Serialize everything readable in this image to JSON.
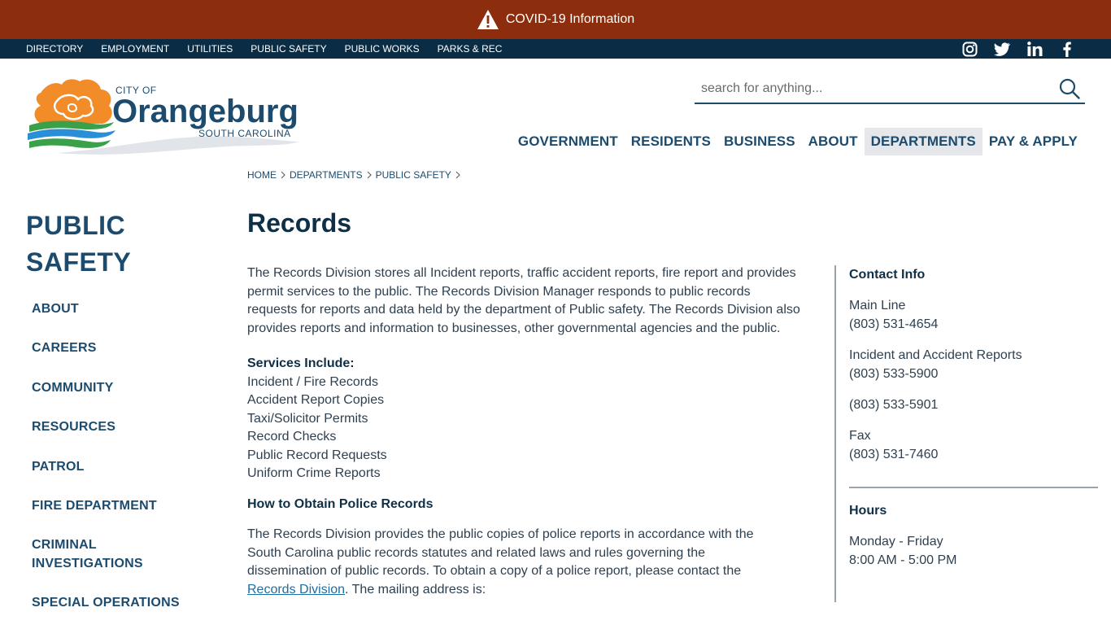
{
  "alert": {
    "label": "COVID-19 Information"
  },
  "utility_nav": [
    "DIRECTORY",
    "EMPLOYMENT",
    "UTILITIES",
    "PUBLIC SAFETY",
    "PUBLIC WORKS",
    "PARKS & REC"
  ],
  "logo": {
    "city_of": "CITY OF",
    "name": "Orangeburg",
    "state": "SOUTH CAROLINA"
  },
  "search": {
    "placeholder": "search for anything..."
  },
  "main_nav": [
    "GOVERNMENT",
    "RESIDENTS",
    "BUSINESS",
    "ABOUT",
    "DEPARTMENTS",
    "PAY & APPLY"
  ],
  "breadcrumb": [
    "HOME",
    "DEPARTMENTS",
    "PUBLIC SAFETY"
  ],
  "sidebar": {
    "title_line1": "PUBLIC",
    "title_line2": "SAFETY",
    "items": [
      "ABOUT",
      "CAREERS",
      "COMMUNITY",
      "RESOURCES",
      "PATROL",
      "FIRE DEPARTMENT",
      "CRIMINAL INVESTIGATIONS",
      "SPECIAL OPERATIONS"
    ]
  },
  "page": {
    "title": "Records",
    "intro": "The Records Division stores all Incident reports, traffic accident reports, fire report and provides permit services to the public. The Records Division Manager responds to public records requests for reports and data held by the department of Public safety. The Records Division also provides reports and information to businesses, other governmental agencies and the public.",
    "services_heading": "Services Include:",
    "services": [
      "Incident / Fire Records",
      "Accident Report Copies",
      "Taxi/Solicitor Permits",
      "Record Checks",
      "Public Record Requests",
      "Uniform Crime Reports"
    ],
    "police_heading": "How to Obtain Police Records",
    "police_text": "The Records Division provides the public copies of police reports in accordance with the South Carolina public records statutes and related laws and rules governing the dissemination of public records. To obtain a copy of a police report, please contact the",
    "police_link": "Records Division",
    "police_tail": ". The mailing address is:"
  },
  "contact": {
    "heading": "Contact Info",
    "main_label": "Main Line",
    "main_phone": "(803) 531-4654",
    "incident_label": "Incident and Accident Reports",
    "incident_phone": "(803) 533-5900",
    "second_phone": "(803) 533-5901",
    "fax_label": "Fax",
    "fax_phone": "(803) 531-7460",
    "hours_heading": "Hours",
    "hours_days": "Monday - Friday",
    "hours_time": "8:00 AM - 5:00 PM"
  },
  "colors": {
    "alert_bg": "#8c2e0d",
    "utility_bg": "#0b2c45",
    "brand_blue": "#1c4b6e",
    "logo_orange": "#f28c28",
    "logo_green": "#3aa04a"
  }
}
